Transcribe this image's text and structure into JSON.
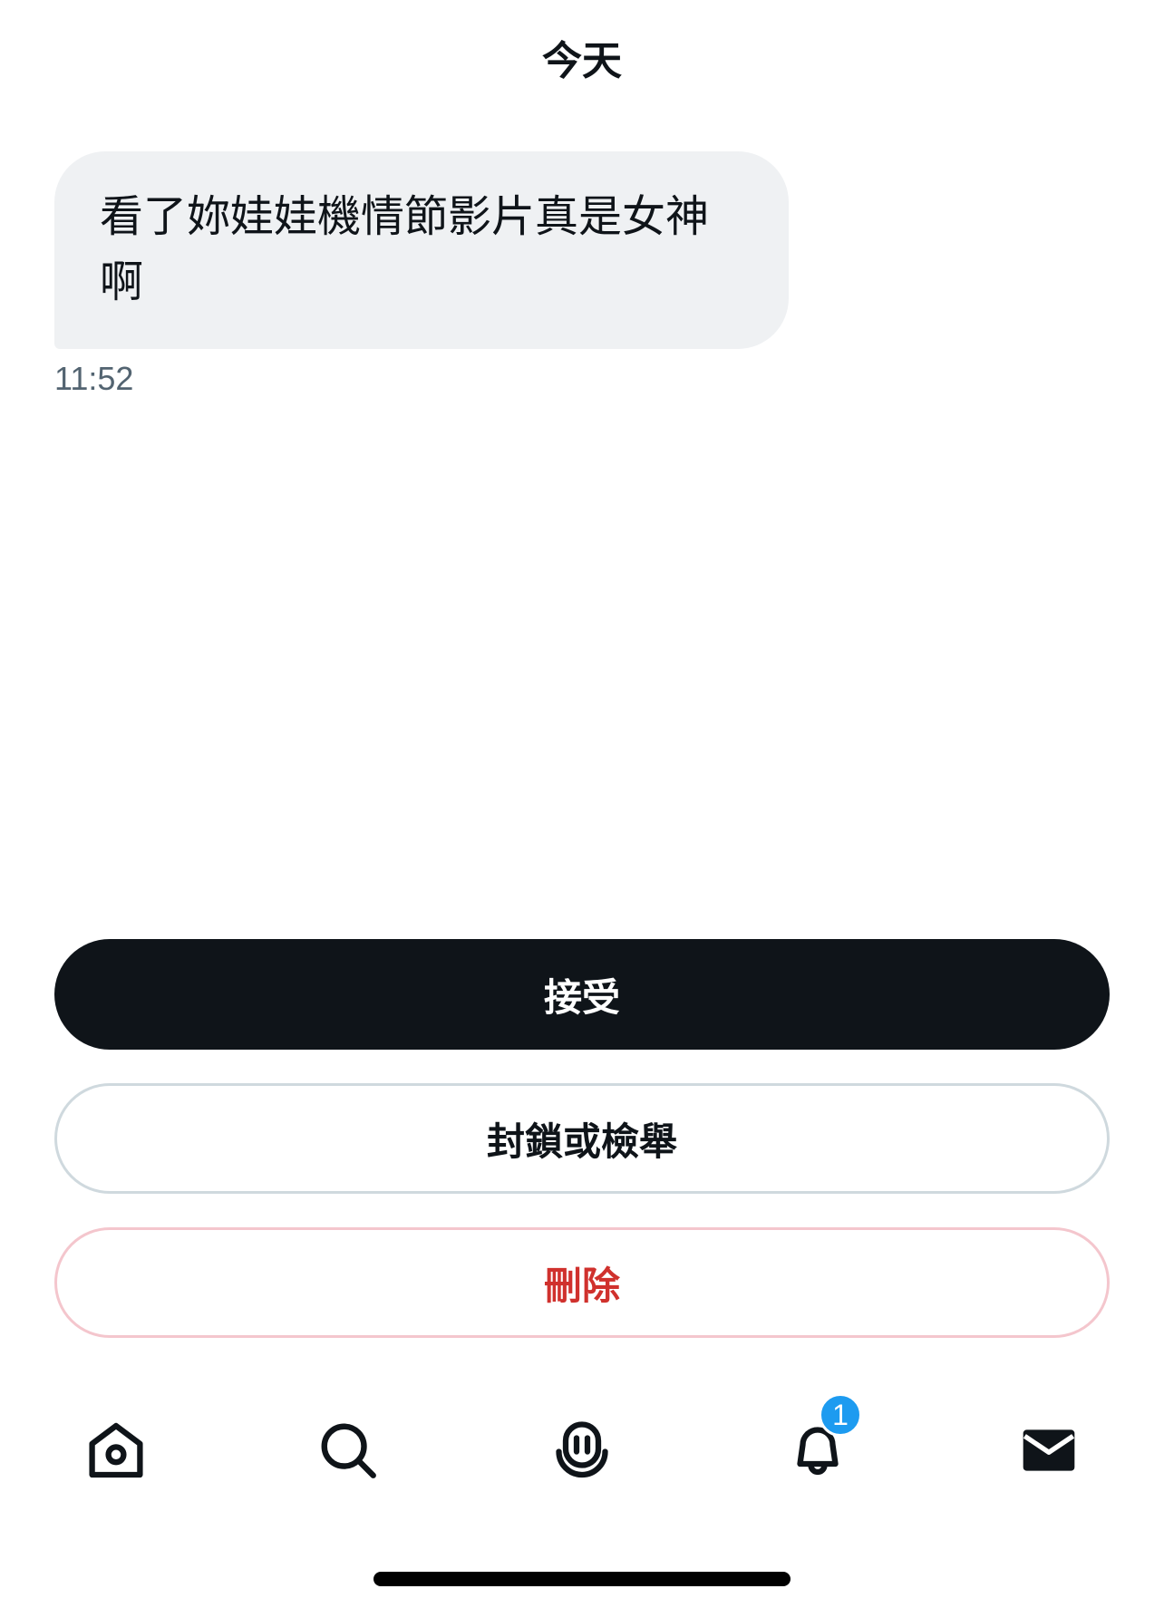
{
  "header": {
    "date_label": "今天"
  },
  "message": {
    "text": "看了妳娃娃機情節影片真是女神啊",
    "time": "11:52"
  },
  "actions": {
    "accept_label": "接受",
    "block_report_label": "封鎖或檢舉",
    "delete_label": "刪除"
  },
  "tabbar": {
    "items": [
      {
        "icon": "home-icon"
      },
      {
        "icon": "search-icon"
      },
      {
        "icon": "spaces-icon"
      },
      {
        "icon": "bell-icon",
        "badge": "1"
      },
      {
        "icon": "mail-icon"
      }
    ]
  },
  "colors": {
    "primary_text": "#0f1419",
    "secondary_text": "#536471",
    "bubble_bg": "#eff1f3",
    "danger": "#d0312d",
    "badge": "#1d9bf0"
  }
}
